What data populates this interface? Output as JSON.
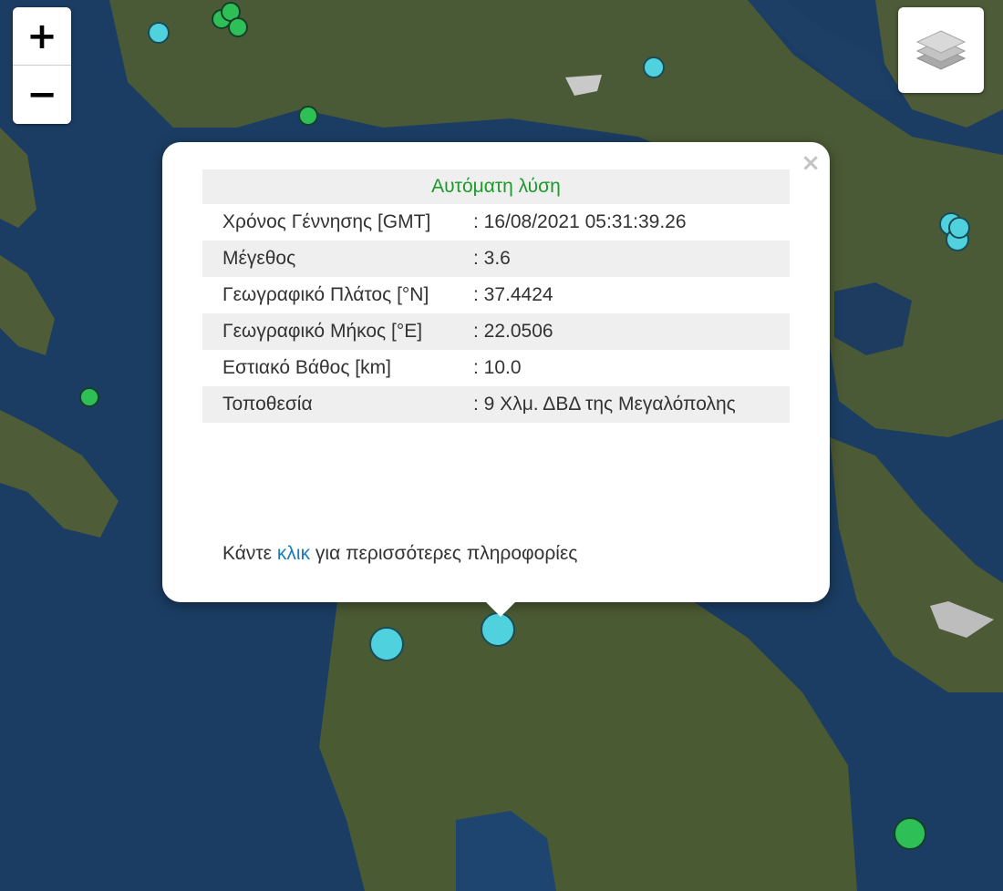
{
  "map": {
    "zoom_in_label": "+",
    "zoom_out_label": "−",
    "layers_icon": "layers-icon",
    "colors": {
      "sea": "#1b3d63",
      "land": "#4a5a35",
      "cyan_marker": "#4fd2de",
      "green_marker": "#2fbf57"
    }
  },
  "popup": {
    "title": "Αυτόματη λύση",
    "close_label": "×",
    "rows": [
      {
        "label": "Χρόνος Γέννησης [GMT]",
        "value": ": 16/08/2021 05:31:39.26"
      },
      {
        "label": "Μέγεθος",
        "value": ": 3.6"
      },
      {
        "label": "Γεωγραφικό Πλάτος [°N]",
        "value": ": 37.4424"
      },
      {
        "label": "Γεωγραφικό Μήκος [°E]",
        "value": ": 22.0506"
      },
      {
        "label": "Εστιακό Βάθος [km]",
        "value": ": 10.0"
      },
      {
        "label": "Τοποθεσία",
        "value": ": 9 Χλμ. ΔΒΔ της Μεγαλόπολης"
      }
    ],
    "more_prefix": "Κάντε",
    "more_link": "κλικ",
    "more_suffix": "για περισσότερες πληροφορίες"
  }
}
